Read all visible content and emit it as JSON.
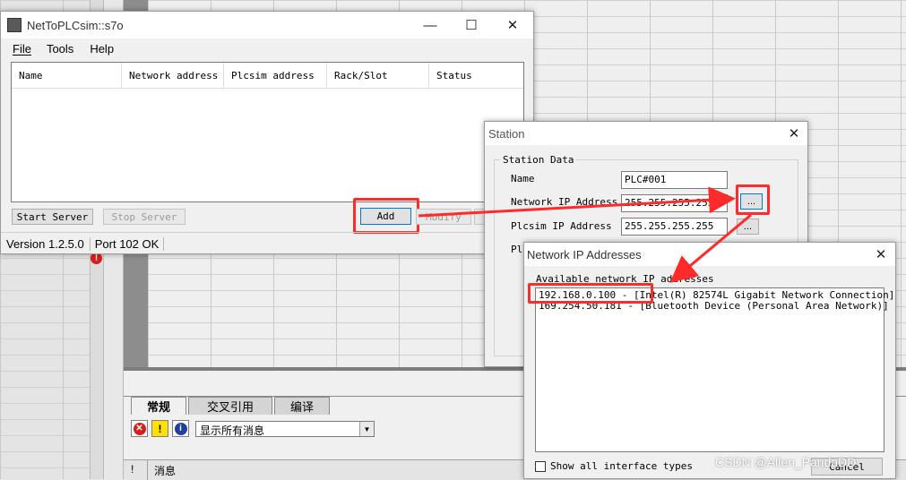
{
  "background": {
    "tabs": [
      "常规",
      "交叉引用",
      "编译"
    ],
    "filter_value": "显示所有消息",
    "messages_header": "消息",
    "messages_col_excl": "!"
  },
  "nettoplc": {
    "title": "NetToPLCsim::s7o",
    "menu": [
      "File",
      "Tools",
      "Help"
    ],
    "columns": [
      "Name",
      "Network address",
      "Plcsim address",
      "Rack/Slot",
      "Status"
    ],
    "buttons": {
      "start": "Start Server",
      "stop": "Stop Server",
      "add": "Add",
      "modify": "Modify"
    },
    "status": {
      "version": "Version 1.2.5.0",
      "port": "Port 102 OK"
    }
  },
  "station": {
    "title": "Station",
    "group": "Station Data",
    "name_label": "Name",
    "name_value": "PLC#001",
    "net_label": "Network IP Address",
    "net_value": "255.255.255.255",
    "plcsim_label": "Plcsim IP Address",
    "plcsim_value": "255.255.255.255",
    "browse": "...",
    "partial_label": "Pl"
  },
  "netip": {
    "title": "Network IP Addresses",
    "available_label": "Available network IP addresses",
    "items": [
      "192.168.0.100 - [Intel(R) 82574L Gigabit Network Connection]",
      "169.254.50.181 - [Bluetooth Device (Personal Area Network)]"
    ],
    "show_all": "Show all interface types",
    "cancel": "Cancel"
  },
  "watermark": "CSDN @Allen_PandaDD",
  "colors": {
    "highlight": "#ff2a2a",
    "accent": "#0078d7"
  }
}
